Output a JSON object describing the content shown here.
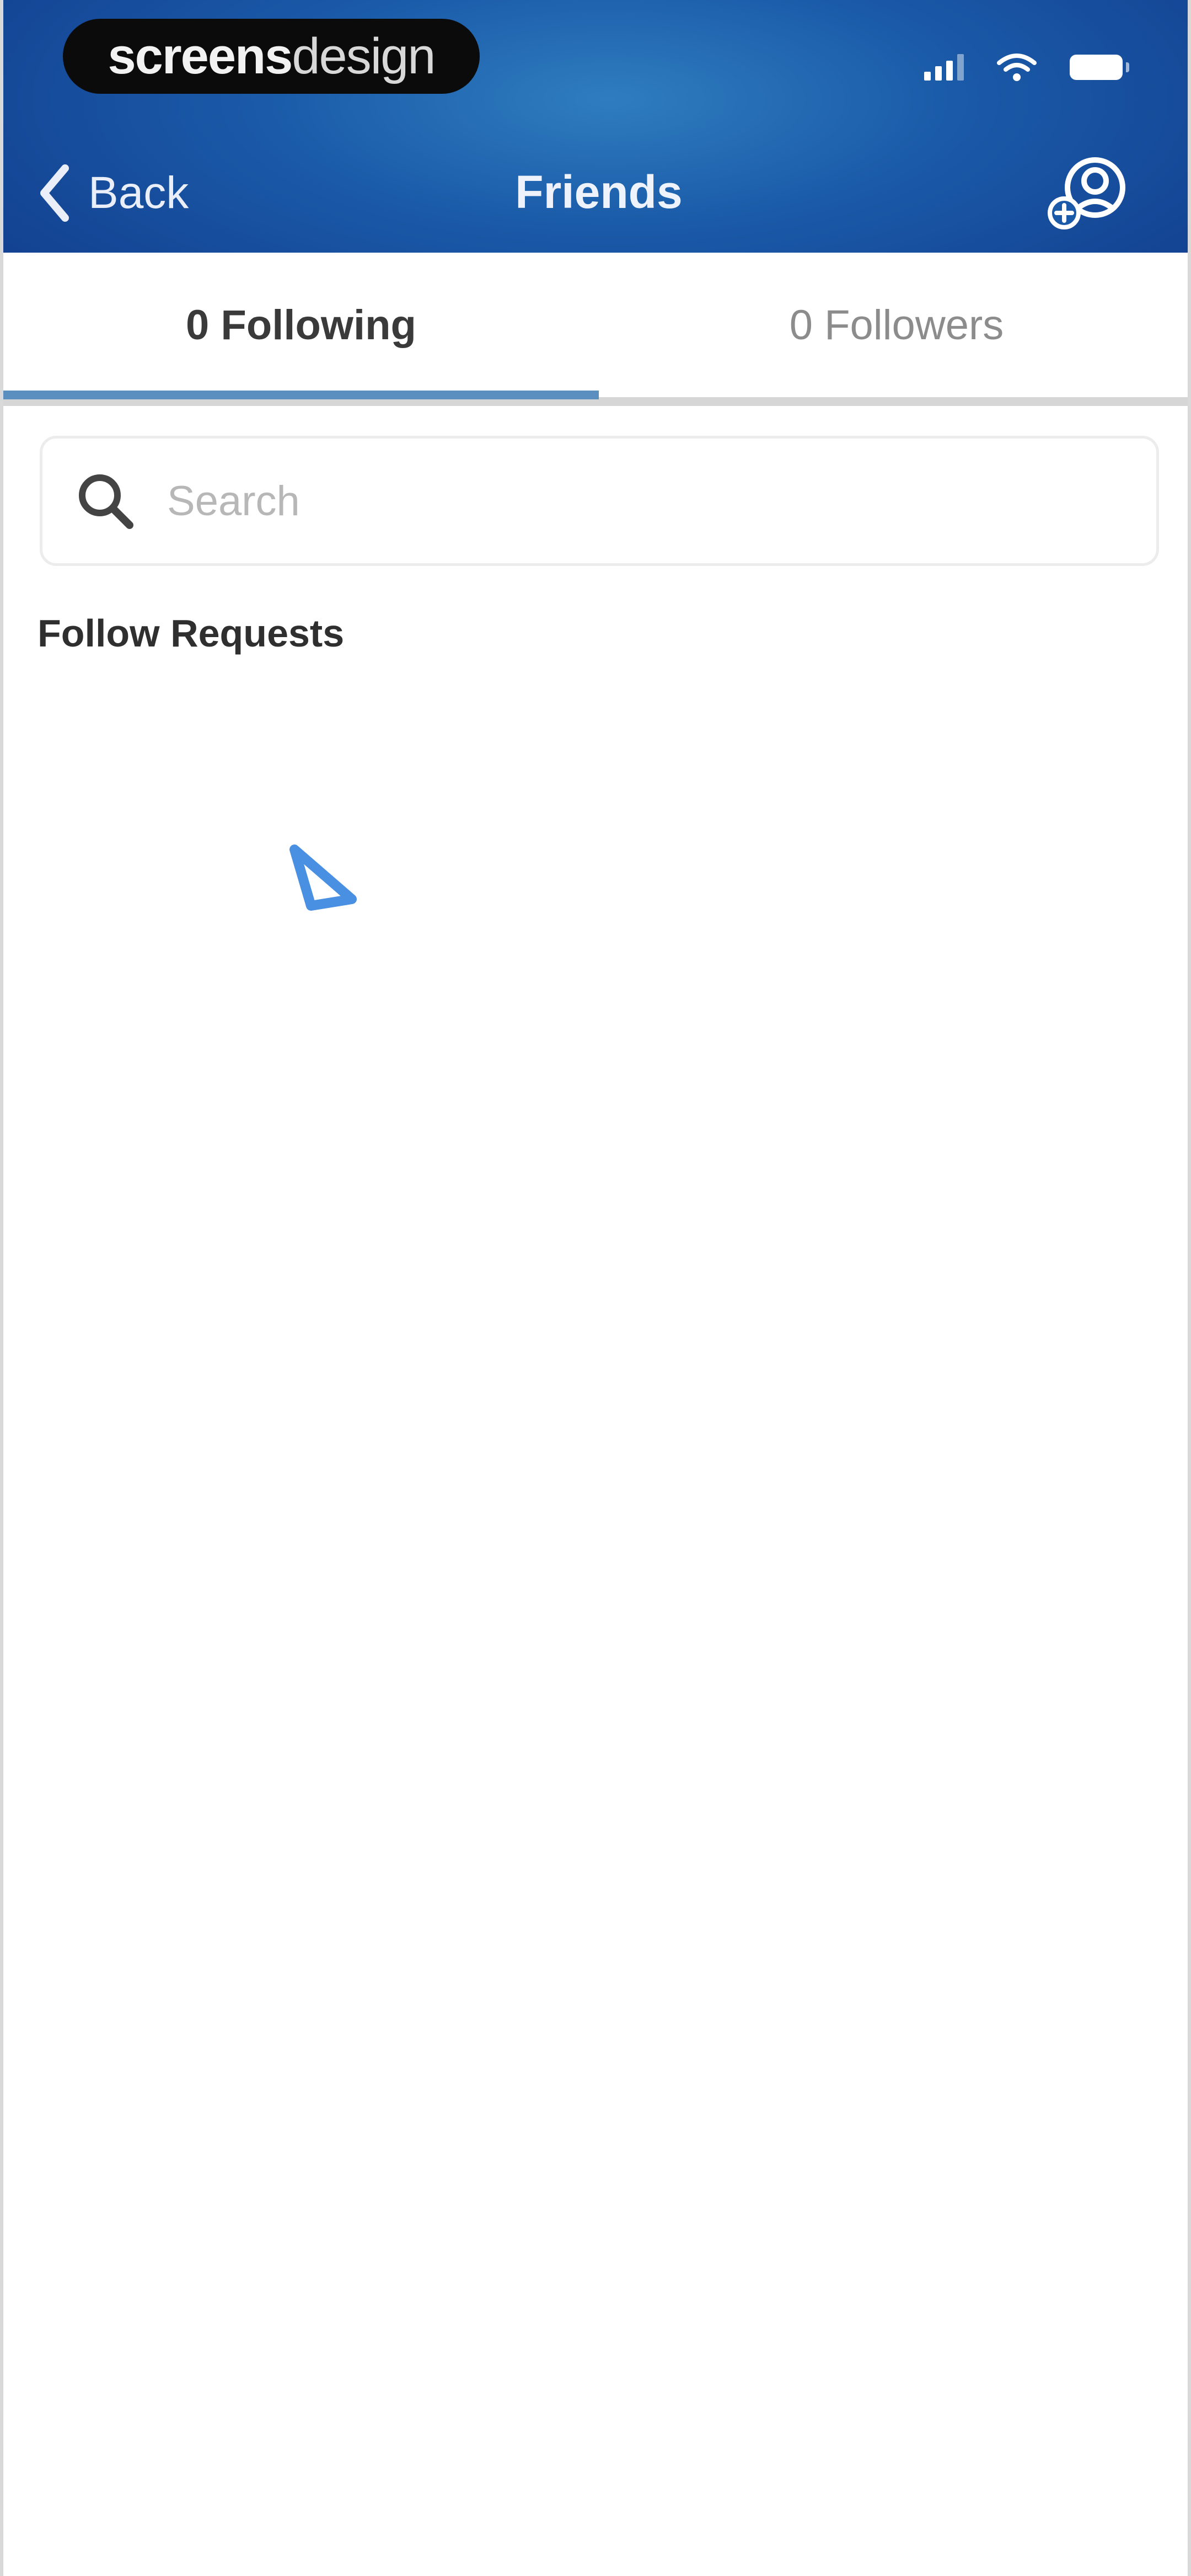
{
  "status_bar": {
    "brand": {
      "part1": "screens",
      "part2": "design"
    },
    "icons": [
      "signal-icon",
      "wifi-icon",
      "battery-icon"
    ]
  },
  "nav": {
    "back_label": "Back",
    "title": "Friends",
    "add_friend_icon": "add-friend-icon"
  },
  "tabs": [
    {
      "label": "0 Following",
      "selected": true
    },
    {
      "label": "0 Followers",
      "selected": false
    }
  ],
  "search": {
    "placeholder": "Search",
    "value": ""
  },
  "section": {
    "title": "Follow Requests"
  },
  "colors": {
    "header_gradient_start": "#2f7dc0",
    "header_gradient_end": "#123f8f",
    "tab_indicator": "#5a8fbf",
    "cursor_accent": "#4a90e2"
  }
}
